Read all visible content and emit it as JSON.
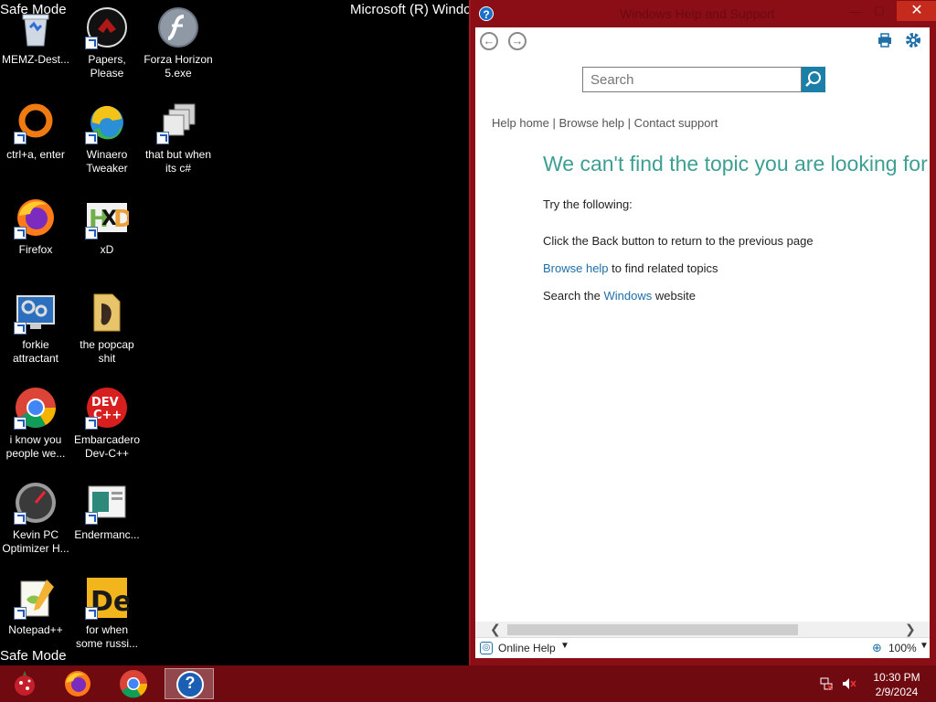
{
  "desktop": {
    "safe_mode_top": "Safe Mode",
    "safe_mode_bottom": "Safe Mode",
    "build_title": "Microsoft (R) Windo",
    "icons": [
      {
        "label": "MEMZ-Dest...",
        "icon": "recycle-bin-icon"
      },
      {
        "label": "Papers, Please",
        "icon": "papers-please-icon"
      },
      {
        "label": "Forza Horizon 5.exe",
        "icon": "flash-icon"
      },
      {
        "label": "ctrl+a, enter",
        "icon": "ring-icon"
      },
      {
        "label": "Winaero Tweaker",
        "icon": "winaero-icon"
      },
      {
        "label": "that but when its c#",
        "icon": "stacked-windows-icon"
      },
      {
        "label": "Firefox",
        "icon": "firefox-icon"
      },
      {
        "label": "xD",
        "icon": "hxd-icon"
      },
      {
        "label": "forkie attractant",
        "icon": "gear-monitor-icon"
      },
      {
        "label": "the popcap shit",
        "icon": "folder-icon"
      },
      {
        "label": "i know you people we...",
        "icon": "chrome-icon"
      },
      {
        "label": "Embarcadero Dev-C++",
        "icon": "dev-cpp-icon"
      },
      {
        "label": "Kevin PC Optimizer H...",
        "icon": "speedometer-icon"
      },
      {
        "label": "Endermanc...",
        "icon": "window-picture-icon"
      },
      {
        "label": "Notepad++",
        "icon": "notepadpp-icon"
      },
      {
        "label": "for when some russi...",
        "icon": "de-icon"
      }
    ]
  },
  "help_window": {
    "title": "Windows Help and Support",
    "help_icon_glyph": "?",
    "min_glyph": "—",
    "max_glyph": "▢",
    "close_glyph": "✕",
    "back_glyph": "←",
    "forward_glyph": "→",
    "search_placeholder": "Search",
    "breadcrumb": {
      "help_home": "Help home",
      "sep1": " | ",
      "browse_help": "Browse help",
      "sep2": " | ",
      "contact_support": "Contact support"
    },
    "heading": "We can't find the topic you are looking for",
    "try_following": "Try the following:",
    "back_instruction": "Click the Back button to return to the previous page",
    "browse_link": "Browse help",
    "browse_rest": " to find related topics",
    "search_prefix": "Search the ",
    "windows_link": "Windows",
    "search_suffix": " website",
    "status": {
      "online_help": "Online Help",
      "zoom": "100%"
    },
    "colors": {
      "frame": "#8b0d16",
      "heading": "#3d9f93",
      "link": "#1e6fa8",
      "search_button": "#1c7fa8"
    }
  },
  "taskbar": {
    "apps": [
      "firefox-icon",
      "chrome-icon",
      "help-icon"
    ],
    "help_glyph": "?",
    "time": "10:30 PM",
    "date": "2/9/2024"
  }
}
